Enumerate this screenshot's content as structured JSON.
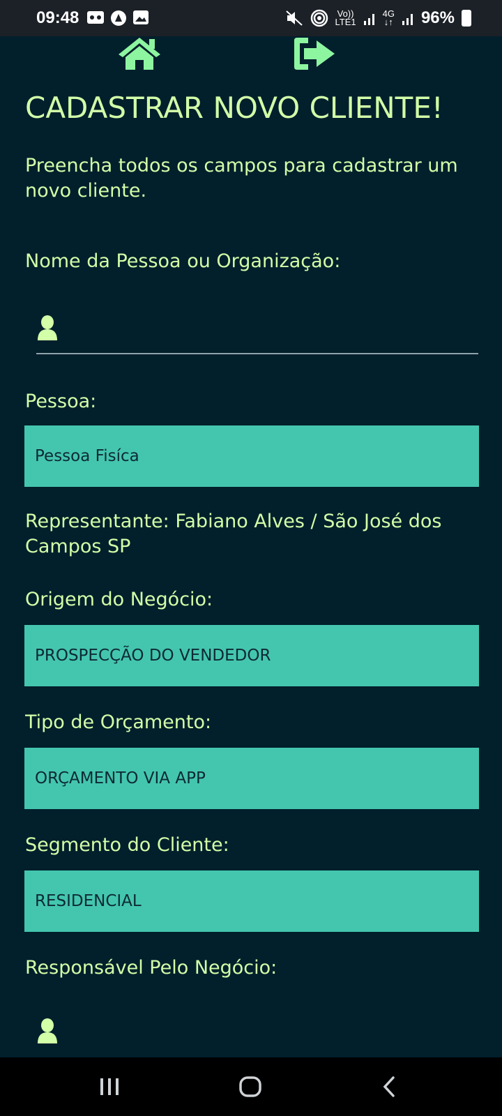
{
  "status_bar": {
    "time": "09:48",
    "signal_top_1": "Vo))",
    "signal_bottom_1": "LTE1",
    "signal_top_2": "4G",
    "signal_bottom_2": "↓↑",
    "battery": "96%"
  },
  "header": {
    "home_icon": "home-icon",
    "logout_icon": "logout-icon"
  },
  "page": {
    "title": "CADASTRAR NOVO CLIENTE!",
    "subtitle": "Preencha todos os campos para cadastrar um novo cliente."
  },
  "form": {
    "name_label": "Nome da Pessoa ou Organização:",
    "name_value": "",
    "pessoa_label": "Pessoa:",
    "pessoa_value": "Pessoa Fisíca",
    "representante_text": "Representante: Fabiano Alves / São José dos Campos SP",
    "origem_label": "Origem do Negócio:",
    "origem_value": "PROSPECÇÃO DO VENDEDOR",
    "tipo_label": "Tipo de Orçamento:",
    "tipo_value": "ORÇAMENTO VIA APP",
    "segmento_label": "Segmento do Cliente:",
    "segmento_value": "RESIDENCIAL",
    "responsavel_label": "Responsável Pelo Negócio:"
  },
  "colors": {
    "background": "#021f2c",
    "text_accent": "#d2ffa8",
    "icon_green": "#8df5a0",
    "select_bg": "#44c6ae"
  }
}
